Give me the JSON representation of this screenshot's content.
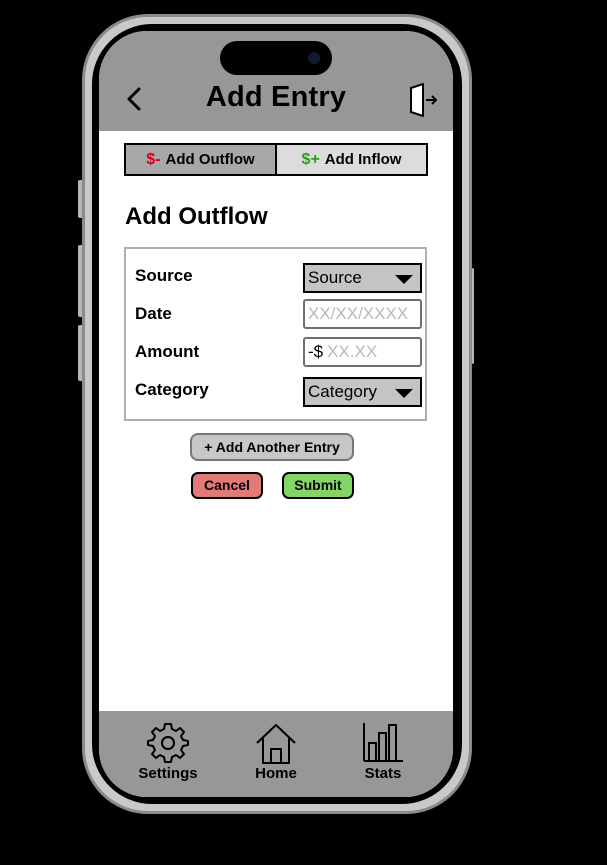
{
  "header": {
    "title": "Add Entry",
    "back_icon": "chevron-left-icon",
    "exit_icon": "exit-door-icon"
  },
  "tabs": [
    {
      "symbol": "$-",
      "label": "Add Outflow",
      "active": true,
      "symbol_color": "#d0021b"
    },
    {
      "symbol": "$+",
      "label": "Add Inflow",
      "active": false,
      "symbol_color": "#2e9e1e"
    }
  ],
  "form": {
    "title": "Add Outflow",
    "fields": {
      "source": {
        "label": "Source",
        "value": "Source"
      },
      "date": {
        "label": "Date",
        "placeholder": "XX/XX/XXXX"
      },
      "amount": {
        "label": "Amount",
        "prefix": "-$",
        "placeholder": "XX.XX"
      },
      "category": {
        "label": "Category",
        "value": "Category"
      }
    }
  },
  "actions": {
    "add_another": "+ Add Another Entry",
    "cancel": "Cancel",
    "submit": "Submit",
    "cancel_color": "#e27a7a",
    "submit_color": "#84d468"
  },
  "nav": {
    "settings": {
      "label": "Settings",
      "icon": "gear-icon"
    },
    "home": {
      "label": "Home",
      "icon": "home-icon"
    },
    "stats": {
      "label": "Stats",
      "icon": "bar-chart-icon"
    }
  }
}
